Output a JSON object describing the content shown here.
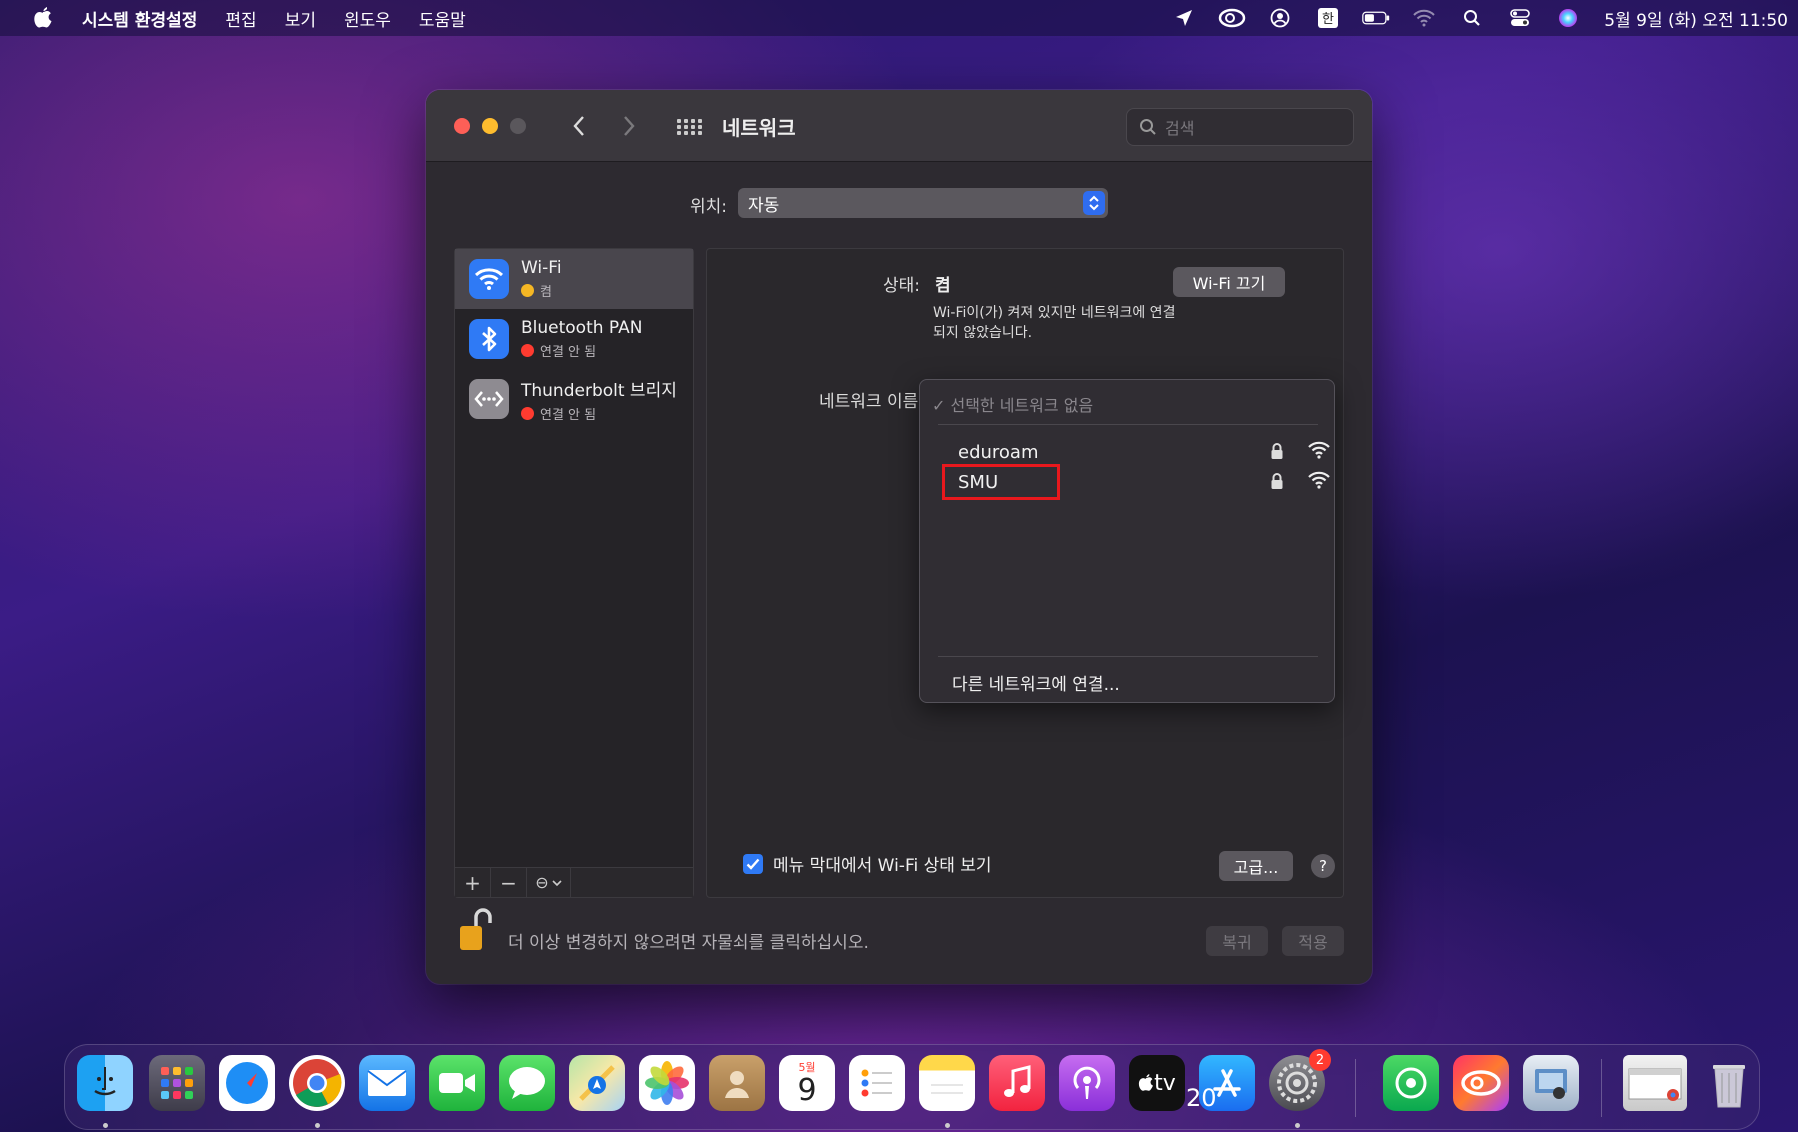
{
  "menubar": {
    "app_name": "시스템 환경설정",
    "items": [
      "편집",
      "보기",
      "윈도우",
      "도움말"
    ],
    "clock": "5월 9일 (화) 오전 11:50"
  },
  "window": {
    "title": "네트워크",
    "search_placeholder": "검색",
    "location_label": "위치:",
    "location_value": "자동"
  },
  "sidebar": {
    "items": [
      {
        "name": "Wi-Fi",
        "status": "켬",
        "status_color": "#f5b724"
      },
      {
        "name": "Bluetooth PAN",
        "status": "연결 안 됨",
        "status_color": "#ff3b30"
      },
      {
        "name": "Thunderbolt 브리지",
        "status": "연결 안 됨",
        "status_color": "#ff3b30"
      }
    ],
    "toolbar": {
      "add": "+",
      "remove": "−",
      "action": "⊖"
    }
  },
  "detail": {
    "status_label": "상태:",
    "status_value": "켬",
    "wifi_off_button": "Wi-Fi 끄기",
    "status_description": "Wi-Fi이(가) 켜져 있지만 네트워크에 연결되지 않았습니다.",
    "network_name_label": "네트워크 이름",
    "dropdown": {
      "none_selected": "✓ 선택한 네트워크 없음",
      "networks": [
        "eduroam",
        "SMU"
      ],
      "other": "다른 네트워크에 연결..."
    },
    "show_wifi_status": "메뉴 막대에서 Wi-Fi 상태 보기",
    "advanced_button": "고급...",
    "help_button": "?"
  },
  "footer": {
    "lock_text": "더 이상 변경하지 않으려면 자물쇠를 클릭하십시오.",
    "revert_button": "복귀",
    "apply_button": "적용"
  },
  "dock": {
    "calendar_month": "5월",
    "calendar_day": "9",
    "settings_badge": "2",
    "tv_label": "tv"
  },
  "page_number": "20",
  "colors": {
    "accent": "#2f7af5",
    "highlight": "#e8181d"
  }
}
